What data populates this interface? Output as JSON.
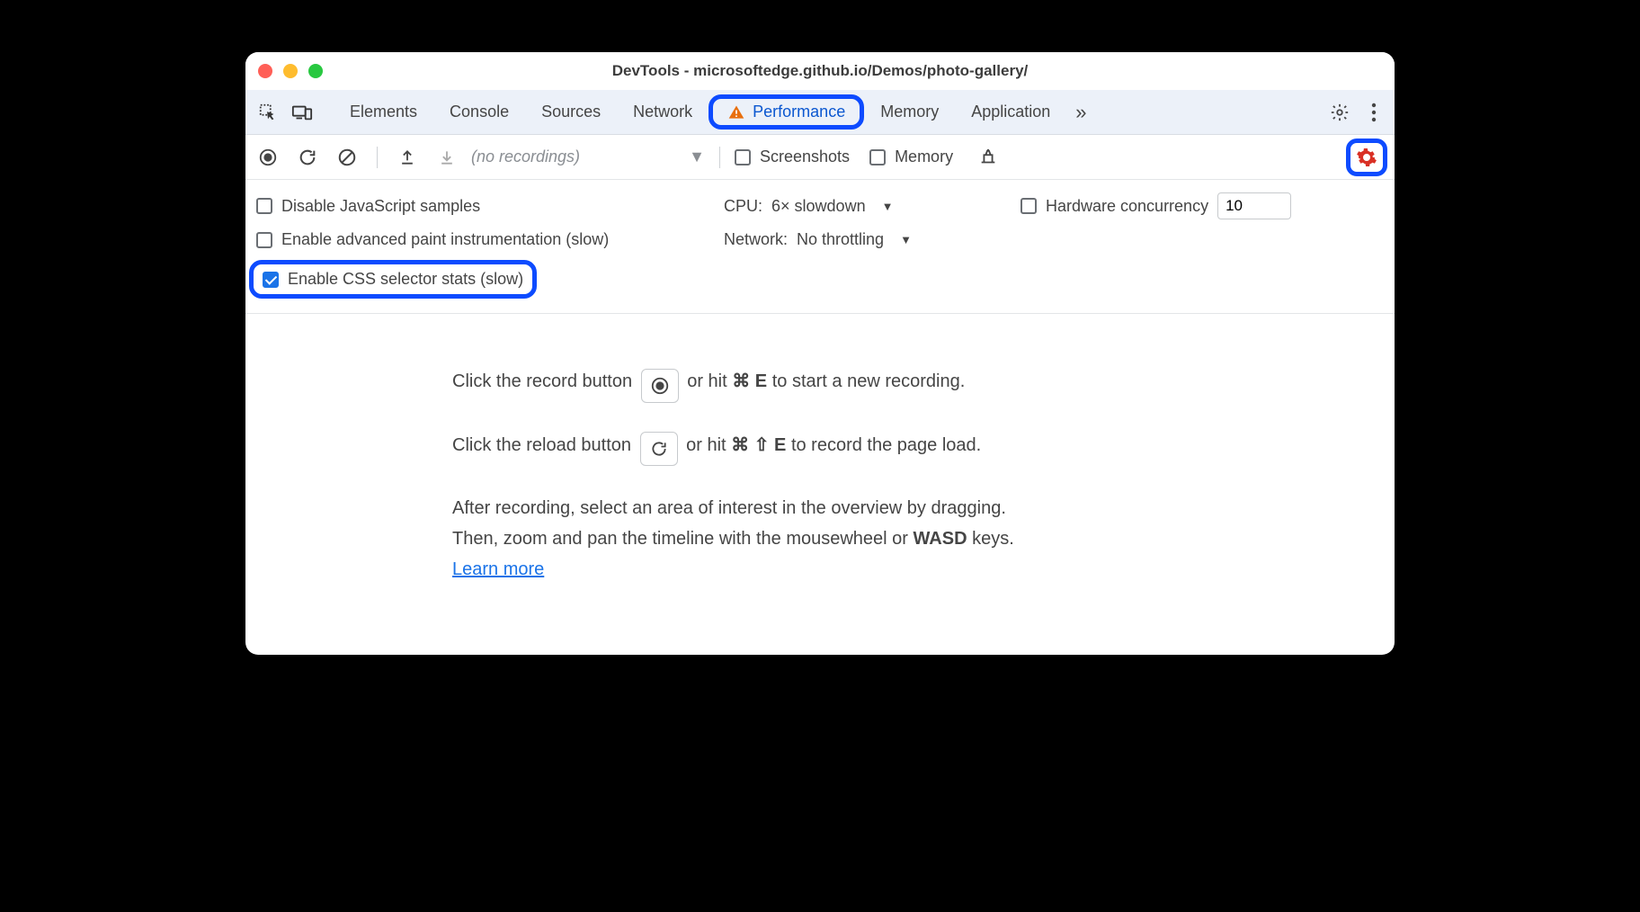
{
  "window": {
    "title": "DevTools - microsoftedge.github.io/Demos/photo-gallery/"
  },
  "tabs": {
    "items": [
      "Elements",
      "Console",
      "Sources",
      "Network",
      "Performance",
      "Memory",
      "Application"
    ],
    "selected": "Performance"
  },
  "toolbar": {
    "recordings_placeholder": "(no recordings)",
    "screenshots_label": "Screenshots",
    "memory_label": "Memory"
  },
  "settings": {
    "disable_js_label": "Disable JavaScript samples",
    "advanced_paint_label": "Enable advanced paint instrumentation (slow)",
    "css_selector_label": "Enable CSS selector stats (slow)",
    "cpu_label": "CPU:",
    "cpu_value": "6× slowdown",
    "network_label": "Network:",
    "network_value": "No throttling",
    "hw_label": "Hardware concurrency",
    "hw_value": "10"
  },
  "landing": {
    "line1a": "Click the record button ",
    "line1b": " or hit ",
    "line1c": " to start a new recording.",
    "shortcut1": "⌘ E",
    "line2a": "Click the reload button ",
    "line2b": " or hit ",
    "line2c": " to record the page load.",
    "shortcut2": "⌘ ⇧ E",
    "line3": "After recording, select an area of interest in the overview by dragging.",
    "line4a": "Then, zoom and pan the timeline with the mousewheel or ",
    "line4b": "WASD",
    "line4c": " keys.",
    "learn_more": "Learn more"
  }
}
